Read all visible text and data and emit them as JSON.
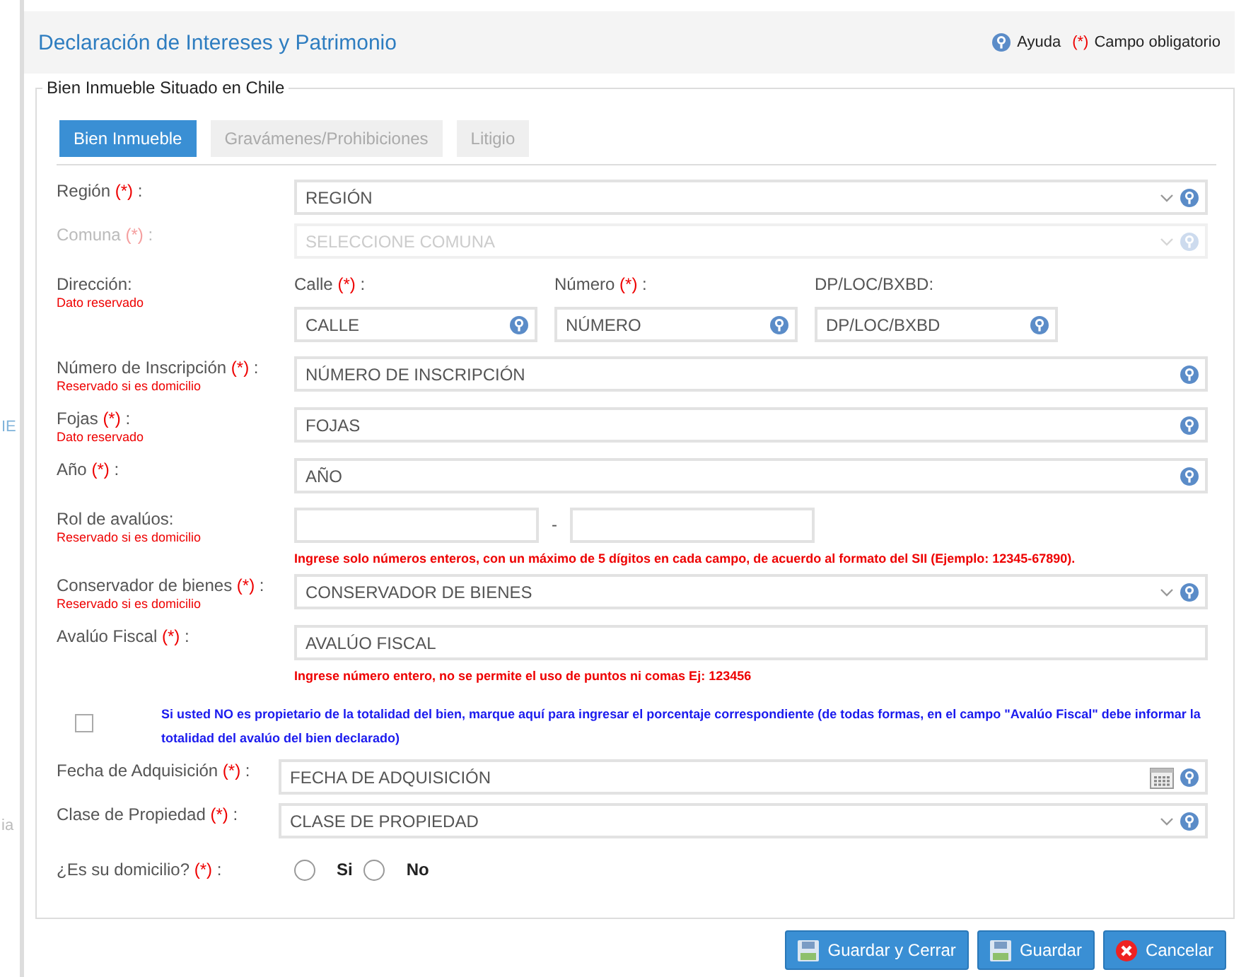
{
  "background": {
    "fragments": [
      "IE",
      "ia"
    ]
  },
  "window": {
    "title": "Declaración de Intereses y Patrimonio",
    "help": "Ayuda",
    "required_marker": "(*)",
    "required_legend": "Campo obligatorio"
  },
  "section": {
    "legend": "Bien Inmueble Situado en Chile"
  },
  "tabs": [
    {
      "label": "Bien Inmueble",
      "selected": true
    },
    {
      "label": "Gravámenes/Prohibiciones",
      "selected": false
    },
    {
      "label": "Litigio",
      "selected": false
    }
  ],
  "rows": [
    {
      "kind": "select",
      "label": "Región",
      "marker": "(*)",
      "colon": ":",
      "value": "REGIÓN",
      "disabled": false
    },
    {
      "kind": "select",
      "label": "Comuna",
      "marker": "(*)",
      "colon": ":",
      "value": "SELECCIONE COMUNA",
      "disabled": true
    },
    {
      "kind": "address",
      "label": "Dirección:",
      "note": "Dato reservado",
      "parts": [
        {
          "label": "Calle",
          "marker": "(*)",
          "colon": ":",
          "placeholder": "CALLE"
        },
        {
          "label": "Número",
          "marker": "(*)",
          "colon": ":",
          "placeholder": "NÚMERO"
        },
        {
          "label": "DP/LOC/BXBD:",
          "placeholder": "DP/LOC/BXBD"
        }
      ]
    },
    {
      "kind": "text",
      "label": "Número de Inscripción",
      "marker": "(*)",
      "colon": ":",
      "note": "Reservado si es domicilio",
      "placeholder": "NÚMERO DE INSCRIPCIÓN",
      "help": true
    },
    {
      "kind": "text",
      "label": "Fojas",
      "marker": "(*)",
      "colon": ":",
      "note": "Dato reservado",
      "placeholder": "FOJAS",
      "help": true
    },
    {
      "kind": "text",
      "label": "Año",
      "marker": "(*)",
      "colon": ":",
      "placeholder": "AÑO",
      "help": true
    },
    {
      "kind": "rol",
      "label": "Rol de avalúos:",
      "note": "Reservado si es domicilio",
      "separator": "-",
      "hint": "Ingrese solo números enteros, con un máximo de 5 dígitos en cada campo, de acuerdo al formato del SII (Ejemplo: 12345-67890)."
    },
    {
      "kind": "select",
      "label": "Conservador de bienes",
      "marker": "(*)",
      "colon": ":",
      "note": "Reservado si es domicilio",
      "value": "CONSERVADOR DE BIENES",
      "disabled": false
    },
    {
      "kind": "text",
      "label": "Avalúo Fiscal",
      "marker": "(*)",
      "colon": ":",
      "placeholder": "AVALÚO FISCAL",
      "help": false,
      "hint": "Ingrese número entero, no se permite el uso de puntos ni comas Ej: 123456"
    },
    {
      "kind": "checkbox",
      "checked": false,
      "text": "Si usted NO es propietario de la totalidad del bien, marque aquí para ingresar el porcentaje correspondiente (de todas formas, en el campo \"Avalúo Fiscal\" debe informar la totalidad del avalúo del bien declarado)"
    },
    {
      "kind": "date",
      "label": "Fecha de Adquisición",
      "marker": "(*)",
      "colon": ":",
      "placeholder": "FECHA DE ADQUISICIÓN"
    },
    {
      "kind": "select",
      "label": "Clase de Propiedad",
      "marker": "(*)",
      "colon": ":",
      "value": "CLASE DE PROPIEDAD",
      "disabled": false
    },
    {
      "kind": "radio",
      "label": "¿Es su domicilio?",
      "marker": "(*)",
      "colon": ":",
      "options": [
        {
          "label": "Si",
          "selected": false
        },
        {
          "label": "No",
          "selected": false
        }
      ]
    }
  ],
  "buttons": [
    {
      "label": "Guardar y Cerrar",
      "kind": "save"
    },
    {
      "label": "Guardar",
      "kind": "save"
    },
    {
      "label": "Cancelar",
      "kind": "cancel"
    }
  ]
}
